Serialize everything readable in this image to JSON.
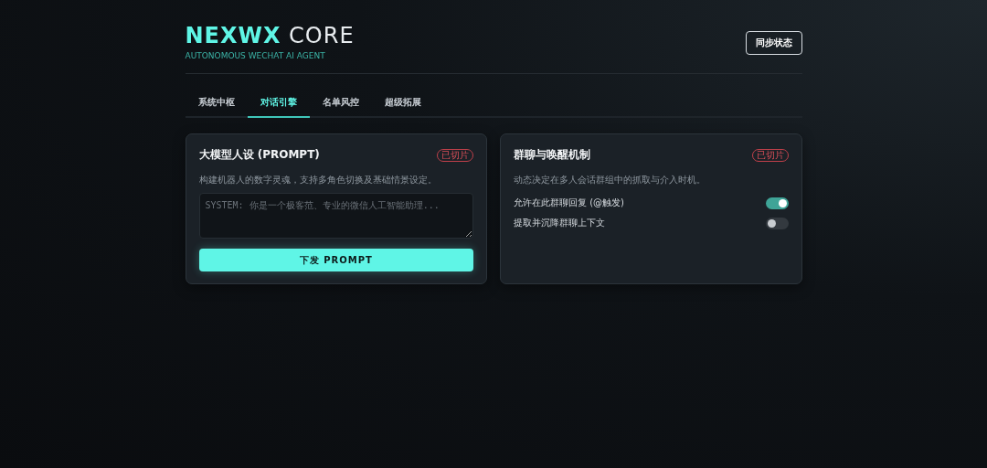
{
  "header": {
    "brand": "NEXWX",
    "brand_suffix": "CORE",
    "subtitle": "AUTONOMOUS WECHAT AI AGENT",
    "sync_button": "同步状态"
  },
  "tabs": [
    {
      "label": "系统中枢",
      "selected": false
    },
    {
      "label": "对话引擎",
      "selected": true
    },
    {
      "label": "名单风控",
      "selected": false
    },
    {
      "label": "超级拓展",
      "selected": false
    }
  ],
  "cards": [
    {
      "kind": "prompt",
      "title": "大模型人设 (PROMPT)",
      "badge": "已切片",
      "description": "构建机器人的数字灵魂，支持多角色切换及基础情景设定。",
      "placeholder": "SYSTEM: 你是一个极客范、专业的微信人工智能助理...",
      "button": "下发 PROMPT"
    },
    {
      "kind": "toggles",
      "title": "群聊与唤醒机制",
      "badge": "已切片",
      "description": "动态决定在多人会话群组中的抓取与介入时机。",
      "toggles": [
        {
          "label": "允许在此群聊回复 (@触发)",
          "on": true
        },
        {
          "label": "提取并沉降群聊上下文",
          "on": false
        }
      ]
    }
  ]
}
